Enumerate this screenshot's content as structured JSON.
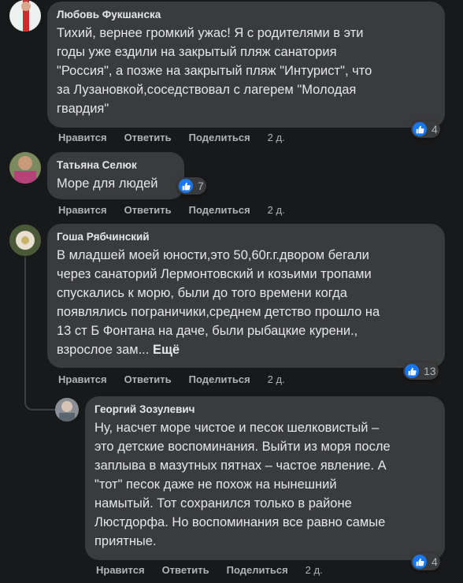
{
  "comments": [
    {
      "author": "Любовь Фукшанска",
      "lines": [
        "Тихий, вернее громкий ужас! Я с родителями в эти",
        "годы уже ездили на закрытый пляж санатория",
        "\"Россия\", а позже на закрытый пляж \"Интурист\", что",
        "за Лузановкой,соседствовал с лагерем \"Молодая",
        "гвардия\""
      ],
      "reaction_count": "4",
      "actions": {
        "like": "Нравится",
        "reply": "Ответить",
        "share": "Поделиться",
        "time": "2 д."
      }
    },
    {
      "author": "Татьяна Селюк",
      "lines": [
        "Море для людей"
      ],
      "reaction_count": "7",
      "actions": {
        "like": "Нравится",
        "reply": "Ответить",
        "share": "Поделиться",
        "time": "2 д."
      }
    },
    {
      "author": "Гоша Рябчинский",
      "lines": [
        "В младшей моей юности,это 50,60г.г.двором бегали",
        "через санаторий Лермонтовский и козьими тропами",
        "спускались к морю, были до того времени когда",
        "появлялись пограничики,среднем детство прошло на",
        "13 ст Б Фонтана на даче, были рыбацкие курени.,"
      ],
      "last_line": "взрослое зам...",
      "more": "Ещё",
      "reaction_count": "13",
      "actions": {
        "like": "Нравится",
        "reply": "Ответить",
        "share": "Поделиться",
        "time": "2 д."
      }
    },
    {
      "author": "Георгий Зозулевич",
      "lines": [
        "Ну, насчет море чистое и песок шелковистый –",
        "это детские воспоминания. Выйти из моря после",
        "заплыва в мазутных пятнах – частое явление. А",
        "\"тот\" песок даже не похож на нынешний",
        "намытый. Тот сохранился только в районе",
        "Люстдорфа. Но воспоминания все равно самые",
        "приятные."
      ],
      "reaction_count": "4",
      "actions": {
        "like": "Нравится",
        "reply": "Ответить",
        "share": "Поделиться",
        "time": "2 д."
      }
    }
  ],
  "colors": {
    "background": "#18191a",
    "bubble": "#3a3b3c",
    "like": "#1877f2",
    "muted": "#b0b3b8"
  },
  "icons": {
    "reaction": "like-thumb-icon"
  }
}
